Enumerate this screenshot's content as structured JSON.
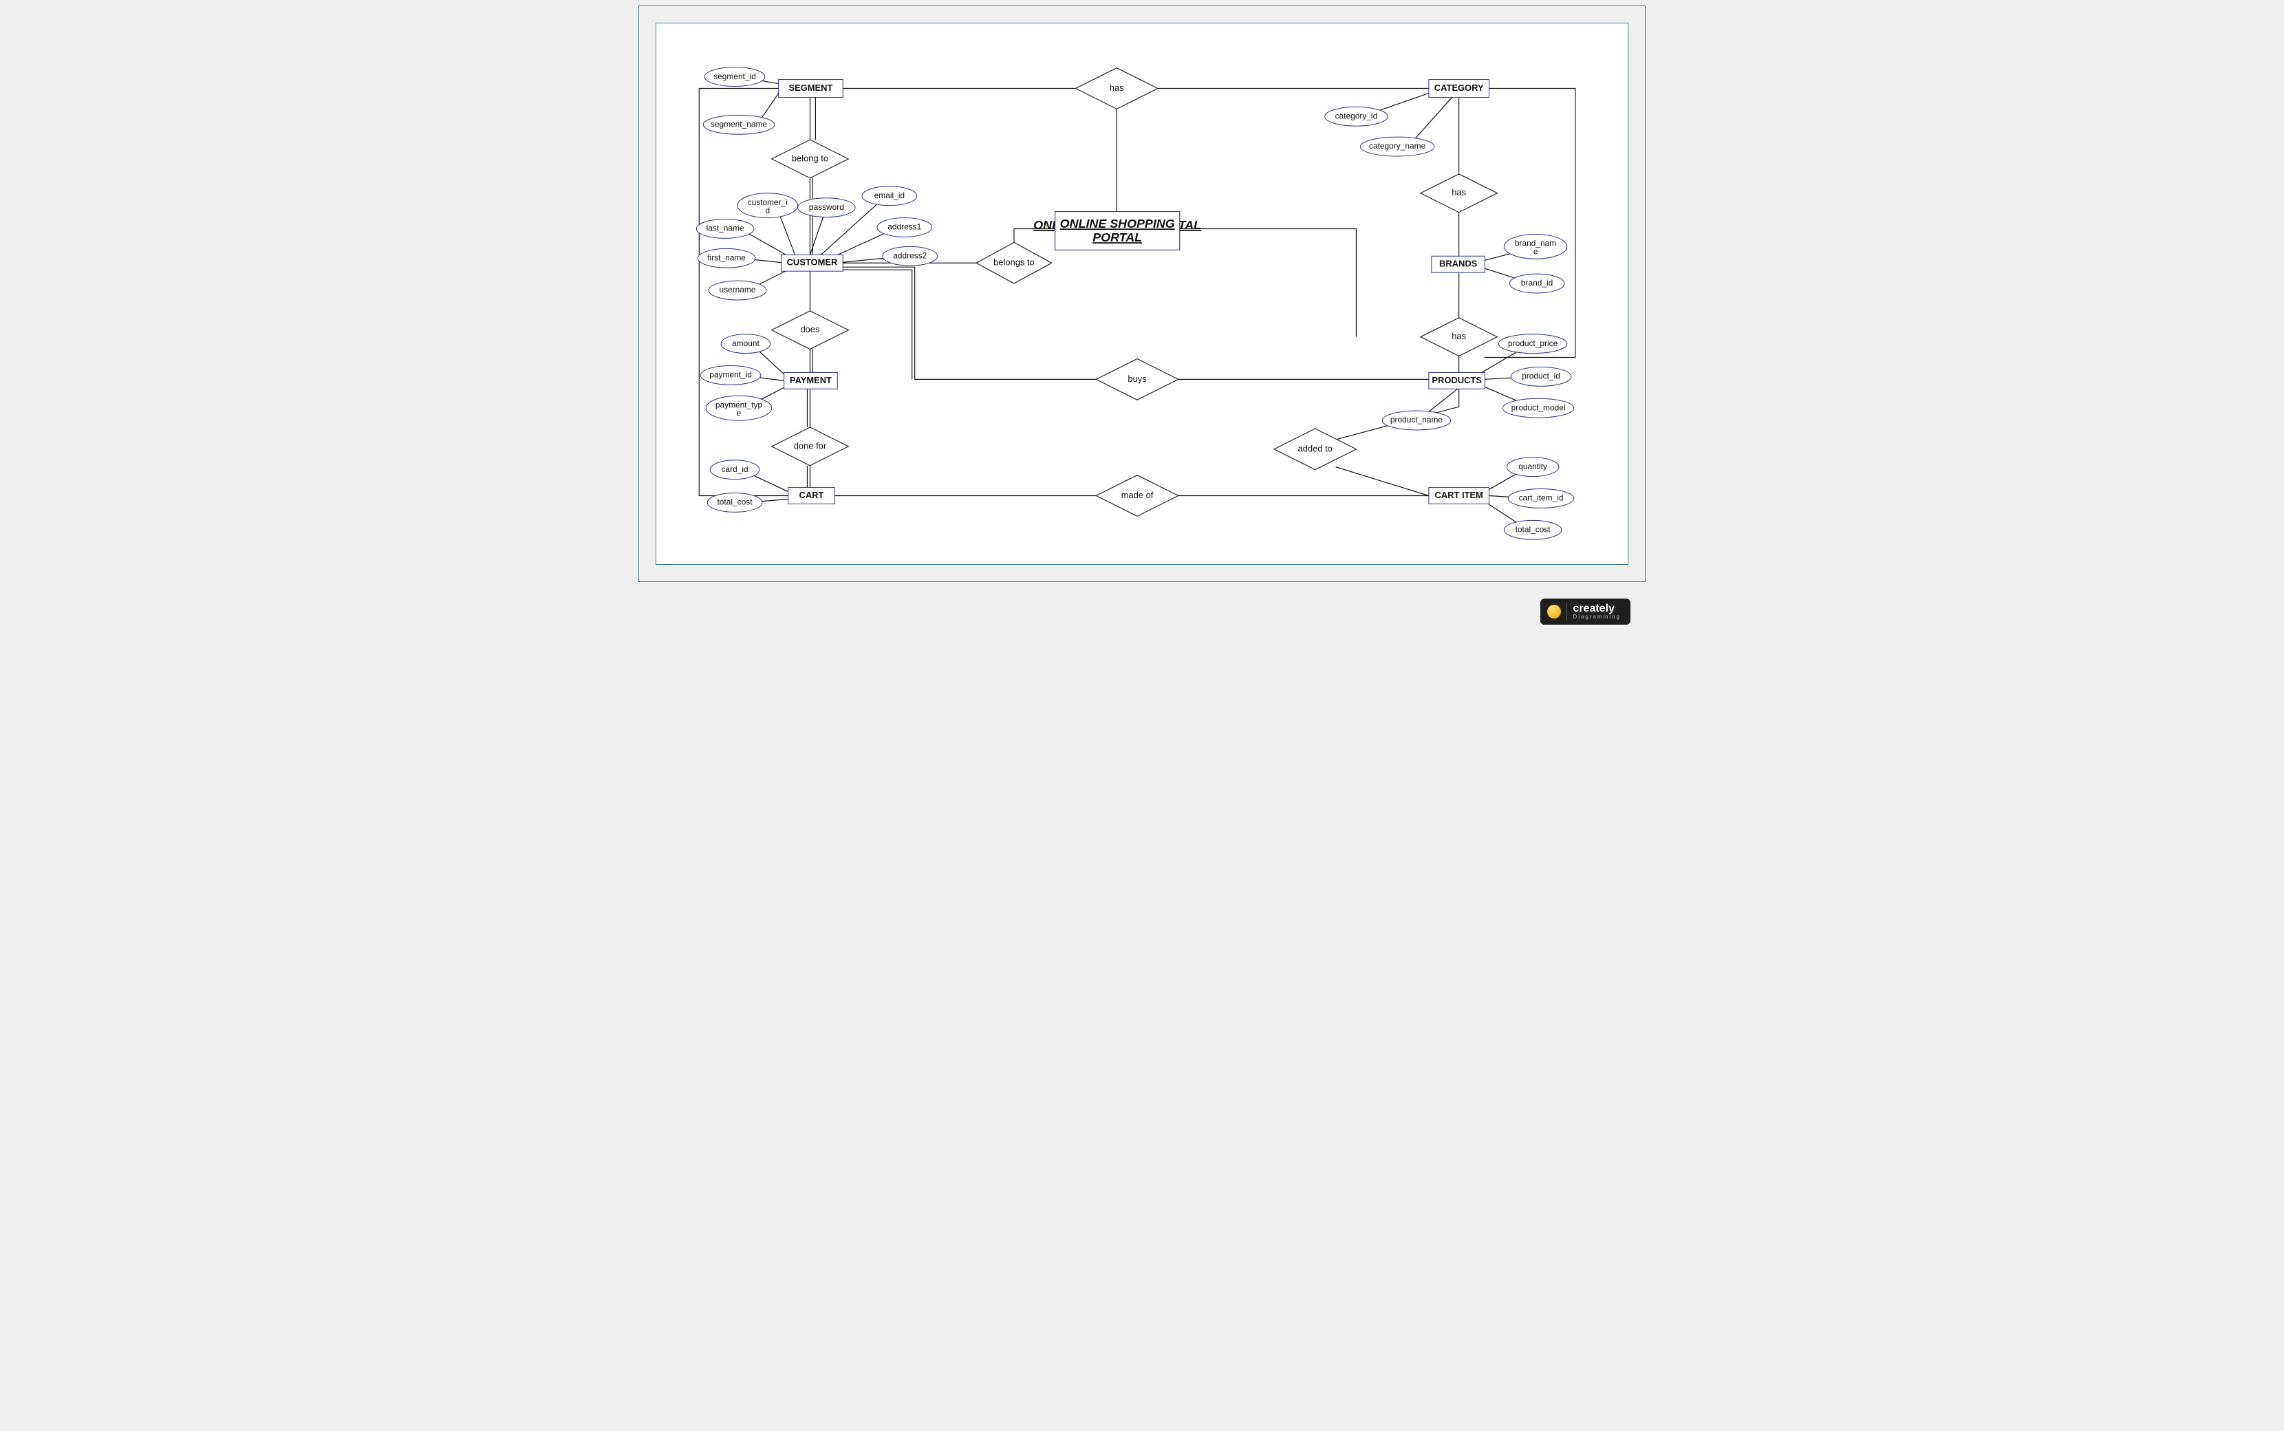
{
  "title": "ONLINE SHOPPING PORTAL",
  "entities": {
    "segment": "SEGMENT",
    "category": "CATEGORY",
    "customer": "CUSTOMER",
    "brands": "BRANDS",
    "payment": "PAYMENT",
    "products": "PRODUCTS",
    "cart": "CART",
    "cart_item": "CART ITEM"
  },
  "relationships": {
    "has_top": "has",
    "belong_to": "belong to",
    "has_cat_brand": "has",
    "belongs_to": "belongs to",
    "does": "does",
    "has_brand_prod": "has",
    "buys": "buys",
    "done_for": "done for",
    "added_to": "added to",
    "made_of": "made of"
  },
  "attributes": {
    "segment_id": "segment_id",
    "segment_name": "segment_name",
    "category_id": "category_id",
    "category_name": "category_name",
    "customer_id": "customer_id",
    "password": "password",
    "email_id": "email_id",
    "address1": "address1",
    "address2": "address2",
    "last_name": "last_name",
    "first_name": "first_name",
    "username": "username",
    "brand_name": "brand_name",
    "brand_id": "brand_id",
    "amount": "amount",
    "payment_id": "payment_id",
    "payment_type": "payment_type",
    "product_price": "product_price",
    "product_id": "product_id",
    "product_model": "product_model",
    "product_name": "product_name",
    "card_id": "card_id",
    "total_cost_cart": "total_cost",
    "quantity": "quantity",
    "cart_item_id": "cart_item_id",
    "total_cost_item": "total_cost"
  },
  "logo": {
    "brand": "creately",
    "tag": "Diagramming"
  }
}
